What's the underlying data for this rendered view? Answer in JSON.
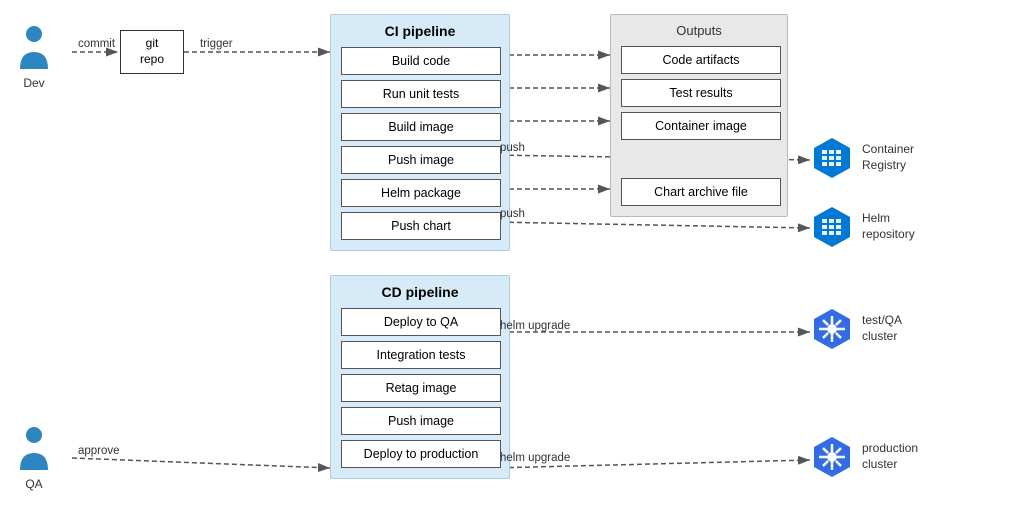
{
  "dev": {
    "label": "Dev",
    "commit_label": "commit"
  },
  "qa": {
    "label": "QA",
    "approve_label": "approve"
  },
  "git_repo": {
    "label": "git\nrepo",
    "trigger_label": "trigger"
  },
  "ci_pipeline": {
    "title": "CI pipeline",
    "steps": [
      "Build code",
      "Run unit tests",
      "Build image",
      "Push image",
      "Helm package",
      "Push chart"
    ]
  },
  "outputs": {
    "title": "Outputs",
    "items": [
      "Code artifacts",
      "Test results",
      "Container image",
      "",
      "Chart archive file",
      ""
    ]
  },
  "cd_pipeline": {
    "title": "CD pipeline",
    "steps": [
      "Deploy to QA",
      "Integration tests",
      "Retag image",
      "Push image",
      "Deploy to production"
    ]
  },
  "push_label_1": "push",
  "push_label_2": "push",
  "helm_upgrade_1": "helm upgrade",
  "helm_upgrade_2": "helm upgrade",
  "registry": {
    "label1": "Container",
    "label2": "Registry"
  },
  "helm_repo": {
    "label1": "Helm",
    "label2": "repository"
  },
  "qa_cluster": {
    "label1": "test/QA",
    "label2": "cluster"
  },
  "prod_cluster": {
    "label1": "production",
    "label2": "cluster"
  }
}
